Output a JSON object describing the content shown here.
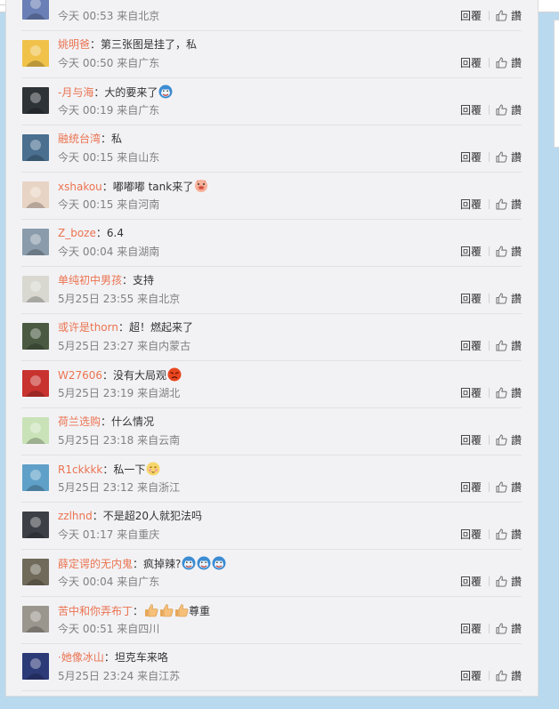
{
  "actions": {
    "reply_label": "回覆",
    "like_label": "讚"
  },
  "comments": [
    {
      "user": "",
      "text": "",
      "time": "今天 00:53",
      "location": "来自北京",
      "avatar_color": "#6a7fb5",
      "emojis": []
    },
    {
      "user": "姚明爸",
      "text": "：第三张图是挂了，私",
      "time": "今天 00:50",
      "location": "来自广东",
      "avatar_color": "#f0c24a",
      "emojis": []
    },
    {
      "user": "-月与海",
      "text": "：大的要来了",
      "time": "今天 00:19",
      "location": "来自广东",
      "avatar_color": "#2e3338",
      "emojis": [
        "doge"
      ]
    },
    {
      "user": "融统台湾",
      "text": "：私",
      "time": "今天 00:15",
      "location": "来自山东",
      "avatar_color": "#4a6f8f",
      "emojis": []
    },
    {
      "user": "xshakou",
      "text": "：嘟嘟嘟 tank来了",
      "time": "今天 00:15",
      "location": "来自河南",
      "avatar_color": "#e8d4c4",
      "emojis": [
        "pig"
      ]
    },
    {
      "user": "Z_boze",
      "text": "：6.4",
      "time": "今天 00:04",
      "location": "来自湖南",
      "avatar_color": "#8a9bab",
      "emojis": []
    },
    {
      "user": "单纯初中男孩",
      "text": "：支持",
      "time": "5月25日 23:55",
      "location": "来自北京",
      "avatar_color": "#d8d8d0",
      "emojis": []
    },
    {
      "user": "或许是thorn",
      "text": "：超！燃起来了",
      "time": "5月25日 23:27",
      "location": "来自内蒙古",
      "avatar_color": "#4a5a42",
      "emojis": []
    },
    {
      "user": "W27606",
      "text": "：没有大局观",
      "time": "5月25日 23:19",
      "location": "来自湖北",
      "avatar_color": "#c8322f",
      "emojis": [
        "angry"
      ]
    },
    {
      "user": "荷兰选购",
      "text": "：什么情况",
      "time": "5月25日 23:18",
      "location": "来自云南",
      "avatar_color": "#c9e2b8",
      "emojis": []
    },
    {
      "user": "R1ckkkk",
      "text": "：私一下",
      "time": "5月25日 23:12",
      "location": "来自浙江",
      "avatar_color": "#5fa0c8",
      "emojis": [
        "shy"
      ]
    },
    {
      "user": "zzlhnd",
      "text": "：不是超20人就犯法吗",
      "time": "今天 01:17",
      "location": "来自重庆",
      "avatar_color": "#3c4046",
      "emojis": []
    },
    {
      "user": "薛定谔的无内鬼",
      "text": "：疯掉辣?",
      "time": "今天 00:04",
      "location": "来自广东",
      "avatar_color": "#6f6a5a",
      "emojis": [
        "doge",
        "doge",
        "doge"
      ]
    },
    {
      "user": "苦中和你弄布丁",
      "text": "：",
      "text_after": "尊重",
      "time": "今天 00:51",
      "location": "来自四川",
      "avatar_color": "#9a968e",
      "emojis": [
        "thumb",
        "thumb",
        "thumb"
      ]
    },
    {
      "user": "·她像冰山",
      "text": "：坦克车来咯",
      "time": "5月25日 23:24",
      "location": "来自江苏",
      "avatar_color": "#2d3a78",
      "emojis": []
    }
  ]
}
